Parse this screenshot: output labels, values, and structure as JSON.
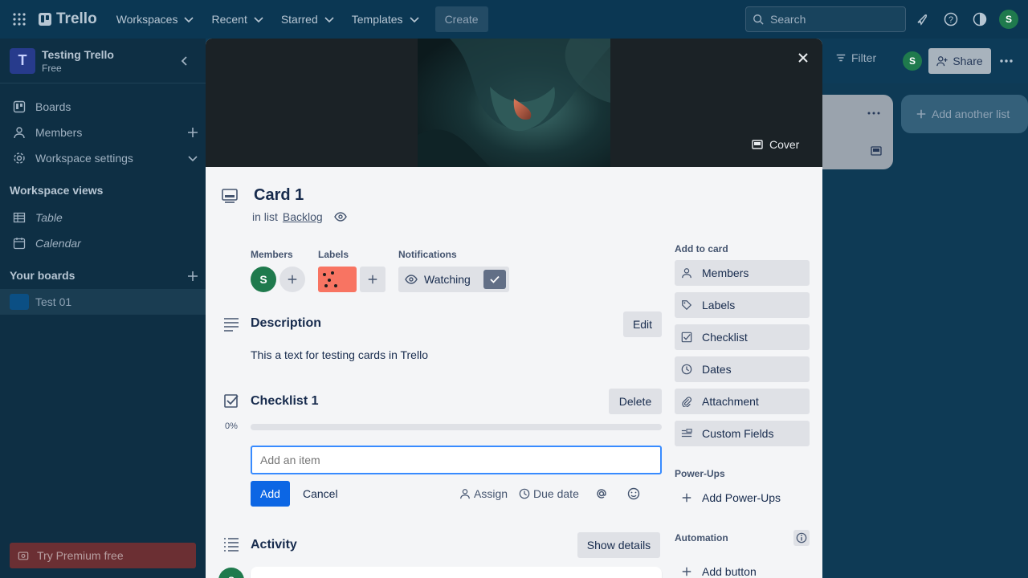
{
  "topbar": {
    "logo": "Trello",
    "nav": [
      "Workspaces",
      "Recent",
      "Starred",
      "Templates"
    ],
    "create": "Create",
    "search_placeholder": "Search",
    "avatar": "S"
  },
  "sidebar": {
    "workspace_initial": "T",
    "workspace_name": "Testing Trello",
    "workspace_plan": "Free",
    "items": [
      {
        "label": "Boards",
        "icon": "trello-icon"
      },
      {
        "label": "Members",
        "icon": "person-icon"
      },
      {
        "label": "Workspace settings",
        "icon": "gear-icon"
      }
    ],
    "views_heading": "Workspace views",
    "views": [
      {
        "label": "Table",
        "icon": "table-icon"
      },
      {
        "label": "Calendar",
        "icon": "calendar-icon"
      }
    ],
    "boards_heading": "Your boards",
    "board": "Test 01",
    "premium": "Try Premium free"
  },
  "board": {
    "filter": "Filter",
    "avatar": "S",
    "share": "Share",
    "add_list": "Add another list"
  },
  "card": {
    "cover_button": "Cover",
    "title": "Card 1",
    "in_list_prefix": "in list",
    "list_name": "Backlog",
    "members_label": "Members",
    "member_avatar": "S",
    "labels_label": "Labels",
    "label_color": "#f87462",
    "notifications_label": "Notifications",
    "watching": "Watching",
    "description": {
      "heading": "Description",
      "edit": "Edit",
      "text": "This a text for testing cards in Trello"
    },
    "checklist": {
      "heading": "Checklist 1",
      "delete": "Delete",
      "percent": "0%",
      "progress": 0,
      "input_placeholder": "Add an item",
      "add": "Add",
      "cancel": "Cancel",
      "assign": "Assign",
      "due_date": "Due date"
    },
    "activity": {
      "heading": "Activity",
      "show_details": "Show details",
      "avatar": "S"
    }
  },
  "add_to_card": {
    "heading": "Add to card",
    "buttons": [
      {
        "label": "Members",
        "icon": "person-icon"
      },
      {
        "label": "Labels",
        "icon": "tag-icon"
      },
      {
        "label": "Checklist",
        "icon": "checklist-icon"
      },
      {
        "label": "Dates",
        "icon": "clock-icon"
      },
      {
        "label": "Attachment",
        "icon": "paperclip-icon"
      },
      {
        "label": "Custom Fields",
        "icon": "custom-fields-icon"
      }
    ],
    "powerups_heading": "Power-Ups",
    "add_powerups": "Add Power-Ups",
    "automation_heading": "Automation",
    "add_button": "Add button"
  },
  "colors": {
    "accent": "#0c66e4",
    "topbar": "#0b3753",
    "sidebar": "#0e2f44",
    "modal_bg": "#f4f5f7",
    "avatar_green": "#1f7a4d"
  }
}
